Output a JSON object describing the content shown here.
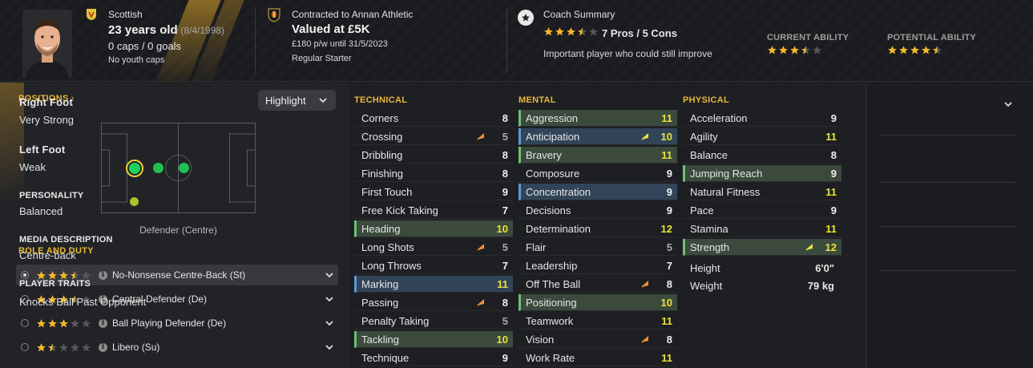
{
  "header": {
    "nationality": "Scottish",
    "age": "23 years old",
    "dob": "(8/4/1998)",
    "caps": "0 caps / 0 goals",
    "youth_caps": "No youth caps",
    "contract": "Contracted to Annan Athletic",
    "value": "Valued at £5K",
    "wage": "£180 p/w until 31/5/2023",
    "squad_status": "Regular Starter",
    "coach_title": "Coach Summary",
    "coach_stars": 3.5,
    "pros_cons": "7 Pros / 5 Cons",
    "coach_note": "Important player who could still improve",
    "current_ability_label": "CURRENT ABILITY",
    "current_ability_stars": 3.5,
    "potential_ability_label": "POTENTIAL ABILITY",
    "potential_ability_stars": 4.5
  },
  "positions": {
    "title": "POSITIONS",
    "highlight_label": "Highlight",
    "position_caption": "Defender (Centre)"
  },
  "roles": {
    "title": "ROLE AND DUTY",
    "items": [
      {
        "label": "No-Nonsense Centre-Back (St)",
        "stars": 3.5,
        "selected": true
      },
      {
        "label": "Central Defender (De)",
        "stars": 3.5,
        "selected": false
      },
      {
        "label": "Ball Playing Defender (De)",
        "stars": 3,
        "selected": false
      },
      {
        "label": "Libero (Su)",
        "stars": 1.5,
        "selected": false
      }
    ]
  },
  "technical": {
    "title": "TECHNICAL",
    "items": [
      {
        "name": "Corners",
        "value": "8",
        "hl": "",
        "arrow": ""
      },
      {
        "name": "Crossing",
        "value": "5",
        "hl": "",
        "arrow": "orange"
      },
      {
        "name": "Dribbling",
        "value": "8",
        "hl": "",
        "arrow": ""
      },
      {
        "name": "Finishing",
        "value": "8",
        "hl": "",
        "arrow": ""
      },
      {
        "name": "First Touch",
        "value": "9",
        "hl": "",
        "arrow": ""
      },
      {
        "name": "Free Kick Taking",
        "value": "7",
        "hl": "",
        "arrow": ""
      },
      {
        "name": "Heading",
        "value": "10",
        "hl": "green",
        "arrow": ""
      },
      {
        "name": "Long Shots",
        "value": "5",
        "hl": "",
        "arrow": "orange"
      },
      {
        "name": "Long Throws",
        "value": "7",
        "hl": "",
        "arrow": ""
      },
      {
        "name": "Marking",
        "value": "11",
        "hl": "blue",
        "arrow": ""
      },
      {
        "name": "Passing",
        "value": "8",
        "hl": "",
        "arrow": "orange"
      },
      {
        "name": "Penalty Taking",
        "value": "5",
        "hl": "",
        "arrow": ""
      },
      {
        "name": "Tackling",
        "value": "10",
        "hl": "green",
        "arrow": ""
      },
      {
        "name": "Technique",
        "value": "9",
        "hl": "",
        "arrow": ""
      }
    ]
  },
  "mental": {
    "title": "MENTAL",
    "items": [
      {
        "name": "Aggression",
        "value": "11",
        "hl": "green",
        "arrow": ""
      },
      {
        "name": "Anticipation",
        "value": "10",
        "hl": "blue",
        "arrow": "yellow"
      },
      {
        "name": "Bravery",
        "value": "11",
        "hl": "green",
        "arrow": ""
      },
      {
        "name": "Composure",
        "value": "9",
        "hl": "",
        "arrow": ""
      },
      {
        "name": "Concentration",
        "value": "9",
        "hl": "blue",
        "arrow": ""
      },
      {
        "name": "Decisions",
        "value": "9",
        "hl": "",
        "arrow": ""
      },
      {
        "name": "Determination",
        "value": "12",
        "hl": "",
        "arrow": ""
      },
      {
        "name": "Flair",
        "value": "5",
        "hl": "",
        "arrow": ""
      },
      {
        "name": "Leadership",
        "value": "7",
        "hl": "",
        "arrow": ""
      },
      {
        "name": "Off The Ball",
        "value": "8",
        "hl": "",
        "arrow": "orange"
      },
      {
        "name": "Positioning",
        "value": "10",
        "hl": "green",
        "arrow": ""
      },
      {
        "name": "Teamwork",
        "value": "11",
        "hl": "",
        "arrow": ""
      },
      {
        "name": "Vision",
        "value": "8",
        "hl": "",
        "arrow": "orange"
      },
      {
        "name": "Work Rate",
        "value": "11",
        "hl": "",
        "arrow": ""
      }
    ]
  },
  "physical": {
    "title": "PHYSICAL",
    "items": [
      {
        "name": "Acceleration",
        "value": "9",
        "hl": "",
        "arrow": ""
      },
      {
        "name": "Agility",
        "value": "11",
        "hl": "",
        "arrow": ""
      },
      {
        "name": "Balance",
        "value": "8",
        "hl": "",
        "arrow": ""
      },
      {
        "name": "Jumping Reach",
        "value": "9",
        "hl": "green",
        "arrow": ""
      },
      {
        "name": "Natural Fitness",
        "value": "11",
        "hl": "",
        "arrow": ""
      },
      {
        "name": "Pace",
        "value": "9",
        "hl": "",
        "arrow": ""
      },
      {
        "name": "Stamina",
        "value": "11",
        "hl": "",
        "arrow": ""
      },
      {
        "name": "Strength",
        "value": "12",
        "hl": "green",
        "arrow": "yellow"
      }
    ],
    "height_label": "Height",
    "height_value": "6'0\"",
    "weight_label": "Weight",
    "weight_value": "79 kg"
  },
  "side": {
    "right_foot_label": "Right Foot",
    "right_foot_value": "Very Strong",
    "left_foot_label": "Left Foot",
    "left_foot_value": "Weak",
    "personality_label": "PERSONALITY",
    "personality_value": "Balanced",
    "media_label": "MEDIA DESCRIPTION",
    "media_value": "Centre-back",
    "traits_label": "PLAYER TRAITS",
    "traits_value": "Knocks Ball Past Opponent"
  },
  "colors": {
    "accent": "#e8b838",
    "high_value": "#e9e23c",
    "highlight_green": "#3b4a3c",
    "highlight_blue": "#324458"
  }
}
